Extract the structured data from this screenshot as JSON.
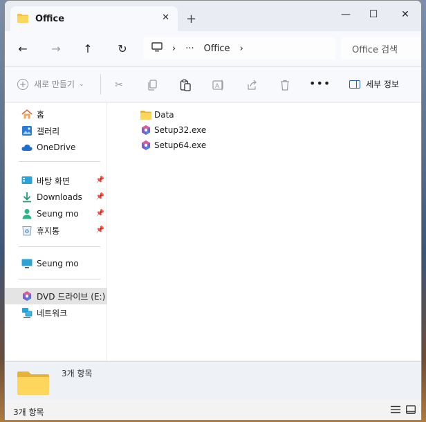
{
  "window": {
    "tab_title": "Office",
    "new_tab": "+",
    "min": "—",
    "max": "☐",
    "close": "✕"
  },
  "nav": {
    "back": "←",
    "forward": "→",
    "up": "↑",
    "refresh": "↻",
    "breadcrumb_more": "···",
    "breadcrumb_sep": "›",
    "current_folder": "Office",
    "search_placeholder": "Office 검색"
  },
  "toolbar": {
    "new_label": "새로 만들기",
    "more": "•••",
    "details_label": "세부 정보"
  },
  "sidebar": {
    "quick": [
      {
        "label": "홈",
        "icon": "home-icon"
      },
      {
        "label": "갤러리",
        "icon": "gallery-icon"
      },
      {
        "label": "OneDrive",
        "icon": "cloud-icon"
      }
    ],
    "pinned": [
      {
        "label": "바탕 화면",
        "icon": "desktop-icon"
      },
      {
        "label": "Downloads",
        "icon": "download-icon"
      },
      {
        "label": "Seung mo",
        "icon": "user-icon"
      },
      {
        "label": "휴지통",
        "icon": "recycle-bin-icon"
      }
    ],
    "pc": {
      "label": "Seung mo",
      "icon": "monitor-icon"
    },
    "drives": [
      {
        "label": "DVD 드라이브 (E:)",
        "icon": "dvd-drive-icon"
      },
      {
        "label": "네트워크",
        "icon": "network-icon"
      }
    ]
  },
  "files": [
    {
      "name": "Data",
      "type": "folder"
    },
    {
      "name": "Setup32.exe",
      "type": "exe"
    },
    {
      "name": "Setup64.exe",
      "type": "exe"
    }
  ],
  "info": {
    "count": "3개 항목"
  },
  "status": {
    "count": "3개 항목"
  }
}
